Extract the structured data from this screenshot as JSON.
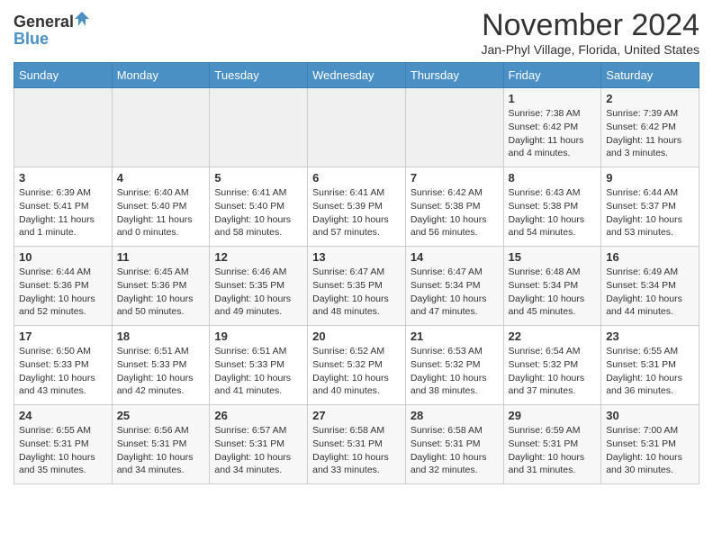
{
  "header": {
    "logo_general": "General",
    "logo_blue": "Blue",
    "month_title": "November 2024",
    "location": "Jan-Phyl Village, Florida, United States"
  },
  "weekdays": [
    "Sunday",
    "Monday",
    "Tuesday",
    "Wednesday",
    "Thursday",
    "Friday",
    "Saturday"
  ],
  "weeks": [
    [
      {
        "day": "",
        "info": ""
      },
      {
        "day": "",
        "info": ""
      },
      {
        "day": "",
        "info": ""
      },
      {
        "day": "",
        "info": ""
      },
      {
        "day": "",
        "info": ""
      },
      {
        "day": "1",
        "info": "Sunrise: 7:38 AM\nSunset: 6:42 PM\nDaylight: 11 hours\nand 4 minutes."
      },
      {
        "day": "2",
        "info": "Sunrise: 7:39 AM\nSunset: 6:42 PM\nDaylight: 11 hours\nand 3 minutes."
      }
    ],
    [
      {
        "day": "3",
        "info": "Sunrise: 6:39 AM\nSunset: 5:41 PM\nDaylight: 11 hours\nand 1 minute."
      },
      {
        "day": "4",
        "info": "Sunrise: 6:40 AM\nSunset: 5:40 PM\nDaylight: 11 hours\nand 0 minutes."
      },
      {
        "day": "5",
        "info": "Sunrise: 6:41 AM\nSunset: 5:40 PM\nDaylight: 10 hours\nand 58 minutes."
      },
      {
        "day": "6",
        "info": "Sunrise: 6:41 AM\nSunset: 5:39 PM\nDaylight: 10 hours\nand 57 minutes."
      },
      {
        "day": "7",
        "info": "Sunrise: 6:42 AM\nSunset: 5:38 PM\nDaylight: 10 hours\nand 56 minutes."
      },
      {
        "day": "8",
        "info": "Sunrise: 6:43 AM\nSunset: 5:38 PM\nDaylight: 10 hours\nand 54 minutes."
      },
      {
        "day": "9",
        "info": "Sunrise: 6:44 AM\nSunset: 5:37 PM\nDaylight: 10 hours\nand 53 minutes."
      }
    ],
    [
      {
        "day": "10",
        "info": "Sunrise: 6:44 AM\nSunset: 5:36 PM\nDaylight: 10 hours\nand 52 minutes."
      },
      {
        "day": "11",
        "info": "Sunrise: 6:45 AM\nSunset: 5:36 PM\nDaylight: 10 hours\nand 50 minutes."
      },
      {
        "day": "12",
        "info": "Sunrise: 6:46 AM\nSunset: 5:35 PM\nDaylight: 10 hours\nand 49 minutes."
      },
      {
        "day": "13",
        "info": "Sunrise: 6:47 AM\nSunset: 5:35 PM\nDaylight: 10 hours\nand 48 minutes."
      },
      {
        "day": "14",
        "info": "Sunrise: 6:47 AM\nSunset: 5:34 PM\nDaylight: 10 hours\nand 47 minutes."
      },
      {
        "day": "15",
        "info": "Sunrise: 6:48 AM\nSunset: 5:34 PM\nDaylight: 10 hours\nand 45 minutes."
      },
      {
        "day": "16",
        "info": "Sunrise: 6:49 AM\nSunset: 5:34 PM\nDaylight: 10 hours\nand 44 minutes."
      }
    ],
    [
      {
        "day": "17",
        "info": "Sunrise: 6:50 AM\nSunset: 5:33 PM\nDaylight: 10 hours\nand 43 minutes."
      },
      {
        "day": "18",
        "info": "Sunrise: 6:51 AM\nSunset: 5:33 PM\nDaylight: 10 hours\nand 42 minutes."
      },
      {
        "day": "19",
        "info": "Sunrise: 6:51 AM\nSunset: 5:33 PM\nDaylight: 10 hours\nand 41 minutes."
      },
      {
        "day": "20",
        "info": "Sunrise: 6:52 AM\nSunset: 5:32 PM\nDaylight: 10 hours\nand 40 minutes."
      },
      {
        "day": "21",
        "info": "Sunrise: 6:53 AM\nSunset: 5:32 PM\nDaylight: 10 hours\nand 38 minutes."
      },
      {
        "day": "22",
        "info": "Sunrise: 6:54 AM\nSunset: 5:32 PM\nDaylight: 10 hours\nand 37 minutes."
      },
      {
        "day": "23",
        "info": "Sunrise: 6:55 AM\nSunset: 5:31 PM\nDaylight: 10 hours\nand 36 minutes."
      }
    ],
    [
      {
        "day": "24",
        "info": "Sunrise: 6:55 AM\nSunset: 5:31 PM\nDaylight: 10 hours\nand 35 minutes."
      },
      {
        "day": "25",
        "info": "Sunrise: 6:56 AM\nSunset: 5:31 PM\nDaylight: 10 hours\nand 34 minutes."
      },
      {
        "day": "26",
        "info": "Sunrise: 6:57 AM\nSunset: 5:31 PM\nDaylight: 10 hours\nand 34 minutes."
      },
      {
        "day": "27",
        "info": "Sunrise: 6:58 AM\nSunset: 5:31 PM\nDaylight: 10 hours\nand 33 minutes."
      },
      {
        "day": "28",
        "info": "Sunrise: 6:58 AM\nSunset: 5:31 PM\nDaylight: 10 hours\nand 32 minutes."
      },
      {
        "day": "29",
        "info": "Sunrise: 6:59 AM\nSunset: 5:31 PM\nDaylight: 10 hours\nand 31 minutes."
      },
      {
        "day": "30",
        "info": "Sunrise: 7:00 AM\nSunset: 5:31 PM\nDaylight: 10 hours\nand 30 minutes."
      }
    ]
  ]
}
